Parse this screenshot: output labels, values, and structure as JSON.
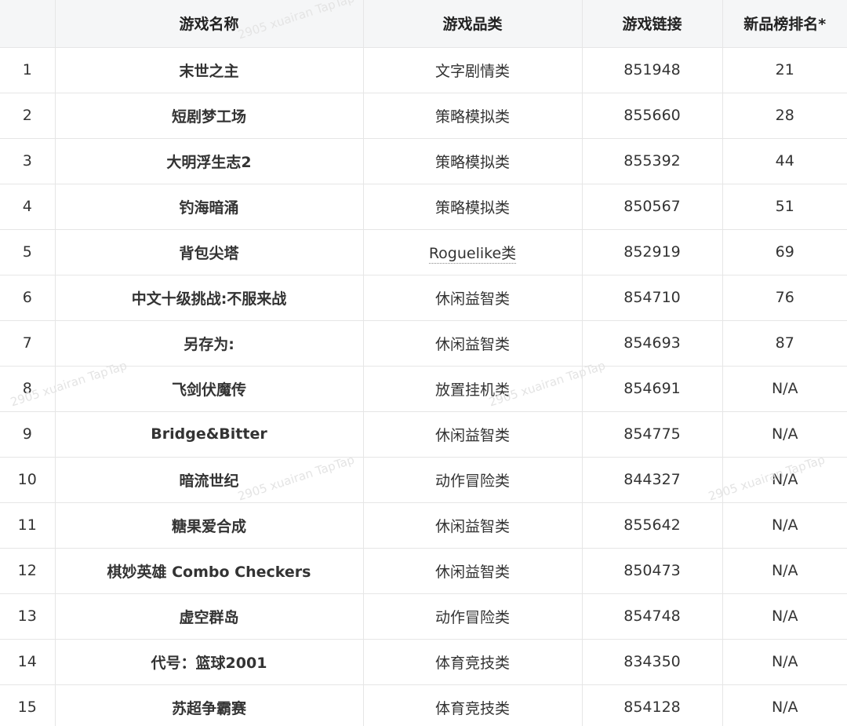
{
  "table": {
    "headers": {
      "number": "",
      "name": "游戏名称",
      "category": "游戏品类",
      "link": "游戏链接",
      "rank": "新品榜排名*"
    },
    "rows": [
      {
        "number": "1",
        "name": "末世之主",
        "category": "文字剧情类",
        "link": "851948",
        "rank": "21"
      },
      {
        "number": "2",
        "name": "短剧梦工场",
        "category": "策略模拟类",
        "link": "855660",
        "rank": "28"
      },
      {
        "number": "3",
        "name": "大明浮生志2",
        "category": "策略模拟类",
        "link": "855392",
        "rank": "44"
      },
      {
        "number": "4",
        "name": "钓海暗涌",
        "category": "策略模拟类",
        "link": "850567",
        "rank": "51"
      },
      {
        "number": "5",
        "name": "背包尖塔",
        "category": "Roguelike类",
        "link": "852919",
        "rank": "69"
      },
      {
        "number": "6",
        "name": "中文十级挑战:不服来战",
        "category": "休闲益智类",
        "link": "854710",
        "rank": "76"
      },
      {
        "number": "7",
        "name": "另存为:",
        "category": "休闲益智类",
        "link": "854693",
        "rank": "87"
      },
      {
        "number": "8",
        "name": "飞剑伏魔传",
        "category": "放置挂机类",
        "link": "854691",
        "rank": "N/A"
      },
      {
        "number": "9",
        "name": "Bridge&Bitter",
        "category": "休闲益智类",
        "link": "854775",
        "rank": "N/A"
      },
      {
        "number": "10",
        "name": "暗流世纪",
        "category": "动作冒险类",
        "link": "844327",
        "rank": "N/A"
      },
      {
        "number": "11",
        "name": "糖果爱合成",
        "category": "休闲益智类",
        "link": "855642",
        "rank": "N/A"
      },
      {
        "number": "12",
        "name": "棋妙英雄 Combo Checkers",
        "category": "休闲益智类",
        "link": "850473",
        "rank": "N/A"
      },
      {
        "number": "13",
        "name": "虚空群岛",
        "category": "动作冒险类",
        "link": "854748",
        "rank": "N/A"
      },
      {
        "number": "14",
        "name": "代号：篮球2001",
        "category": "体育竞技类",
        "link": "834350",
        "rank": "N/A"
      },
      {
        "number": "15",
        "name": "苏超争霸赛",
        "category": "体育竞技类",
        "link": "854128",
        "rank": "N/A"
      }
    ]
  },
  "watermark": {
    "text": "2905 xuairan TapTap"
  },
  "colors": {
    "link": "#2f6fd6",
    "header_bg": "#f5f6f7",
    "border": "#e6e6e6"
  }
}
